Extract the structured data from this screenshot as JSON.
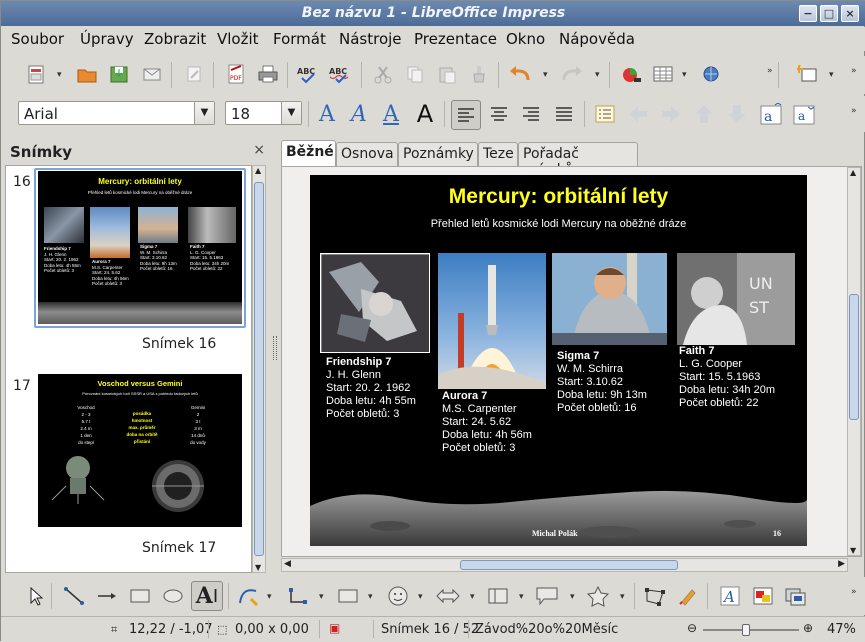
{
  "window": {
    "title": "Bez názvu 1 - LibreOffice Impress",
    "buttons": [
      "−",
      "□",
      "×"
    ]
  },
  "menu": [
    "Soubor",
    "Úpravy",
    "Zobrazit",
    "Vložit",
    "Formát",
    "Nástroje",
    "Prezentace",
    "Okno",
    "Nápověda"
  ],
  "formatting": {
    "font_name": "Arial",
    "font_size": "18"
  },
  "slides_panel": {
    "title": "Snímky",
    "close": "×",
    "items": [
      {
        "number": "16",
        "label": "Snímek 16"
      },
      {
        "number": "17",
        "label": "Snímek 17"
      }
    ],
    "thumb17": {
      "title": "Voschod versus Gemini",
      "subtitle": "Porovnání kosmických lodí SSSR a USA z pohledu řadových letů",
      "col1": [
        "Voschod",
        "2 - 3",
        "5.7 t",
        "2.4 m",
        "1 den",
        "do stepi"
      ],
      "col2": [
        "posádka",
        "hmotnost",
        "max. průměr",
        "doba na orbitě",
        "přistání"
      ],
      "col3": [
        "Gemini",
        "2",
        "3 t",
        "3 m",
        "14 dnů",
        "do vody"
      ]
    }
  },
  "view_tabs": [
    "Běžné",
    "Osnova",
    "Poznámky",
    "Teze",
    "Pořadač snímků"
  ],
  "active_tab": "Běžné",
  "slide": {
    "title": "Mercury: orbitální lety",
    "subtitle": "Přehled letů kosmické lodi Mercury na oběžné dráze",
    "author": "Michal Polák",
    "page": "16",
    "flights": [
      {
        "name": "Friendship 7",
        "pilot": "J. H. Glenn",
        "start": "Start: 20. 2. 1962",
        "duration": "Doba letu: 4h 55m",
        "orbits": "Počet obletů: 3"
      },
      {
        "name": "Aurora 7",
        "pilot": "M.S. Carpenter",
        "start": "Start: 24. 5.62",
        "duration": "Doba letu: 4h 56m",
        "orbits": "Počet obletů: 3"
      },
      {
        "name": "Sigma 7",
        "pilot": "W. M. Schirra",
        "start": "Start: 3.10.62",
        "duration": "Doba letu: 9h 13m",
        "orbits": "Počet obletů: 16"
      },
      {
        "name": "Faith 7",
        "pilot": "L. G. Cooper",
        "start": "Start: 15. 5.1963",
        "duration": "Doba letu: 34h 20m",
        "orbits": "Počet obletů: 22"
      }
    ]
  },
  "status": {
    "position": "12,22 / -1,07",
    "size": "0,00 x 0,00",
    "slide_counter": "Snímek 16 / 52",
    "master": "Závod%20o%20Měsíc",
    "zoom": "47%",
    "zoom_fraction": 0.47
  }
}
